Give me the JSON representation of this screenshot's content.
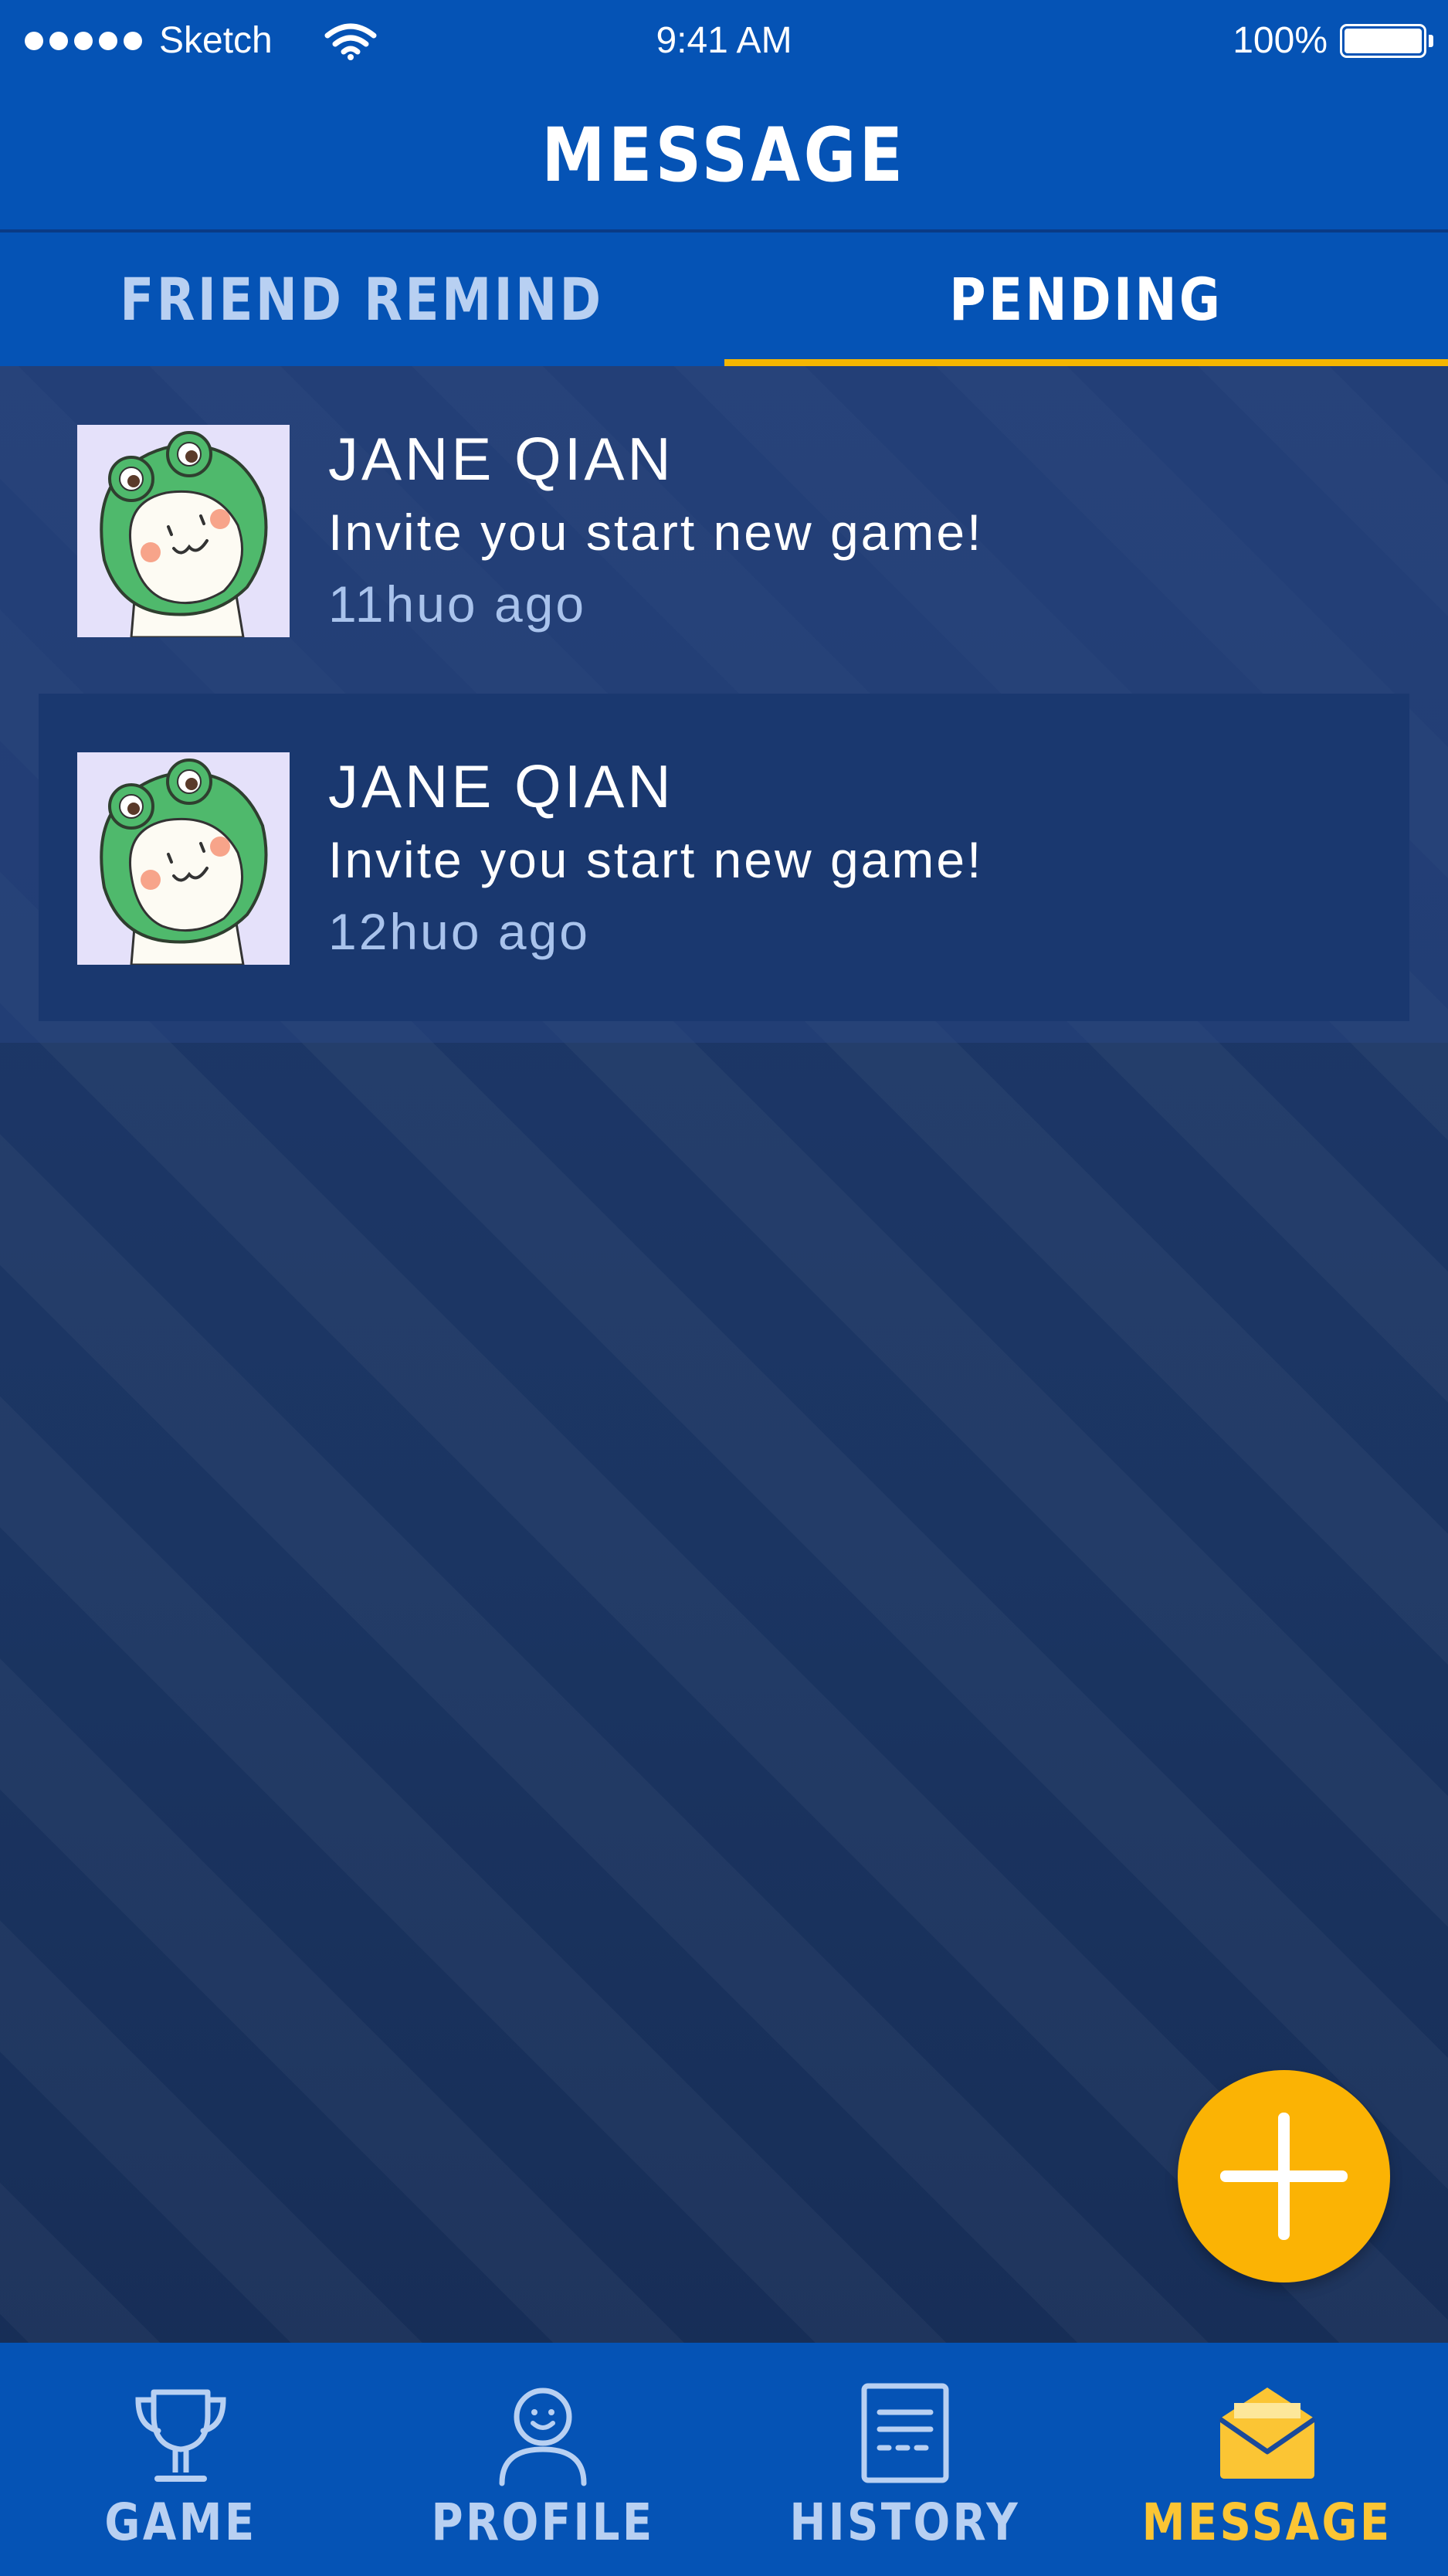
{
  "status_bar": {
    "carrier": "Sketch",
    "time": "9:41 AM",
    "battery": "100%"
  },
  "header": {
    "title": "MESSAGE"
  },
  "tabs": [
    {
      "label": "FRIEND REMIND",
      "active": false
    },
    {
      "label": "PENDING",
      "active": true
    }
  ],
  "messages": [
    {
      "name": "JANE QIAN",
      "text": "Invite you start new game!",
      "time": "11huo ago",
      "avatar_icon": "frog-hood-avatar"
    },
    {
      "name": "JANE QIAN",
      "text": "Invite you start new game!",
      "time": "12huo ago",
      "avatar_icon": "frog-hood-avatar"
    }
  ],
  "fab": {
    "icon": "plus-icon"
  },
  "bottom_nav": [
    {
      "label": "GAME",
      "icon": "trophy-icon",
      "active": false
    },
    {
      "label": "PROFILE",
      "icon": "user-icon",
      "active": false
    },
    {
      "label": "HISTORY",
      "icon": "document-icon",
      "active": false
    },
    {
      "label": "MESSAGE",
      "icon": "envelope-icon",
      "active": true
    }
  ],
  "colors": {
    "primary": "#0553b5",
    "accent": "#fbb304",
    "active_nav": "#fbc534",
    "inactive_text": "#b8d0f2",
    "background": "#1b3562"
  }
}
